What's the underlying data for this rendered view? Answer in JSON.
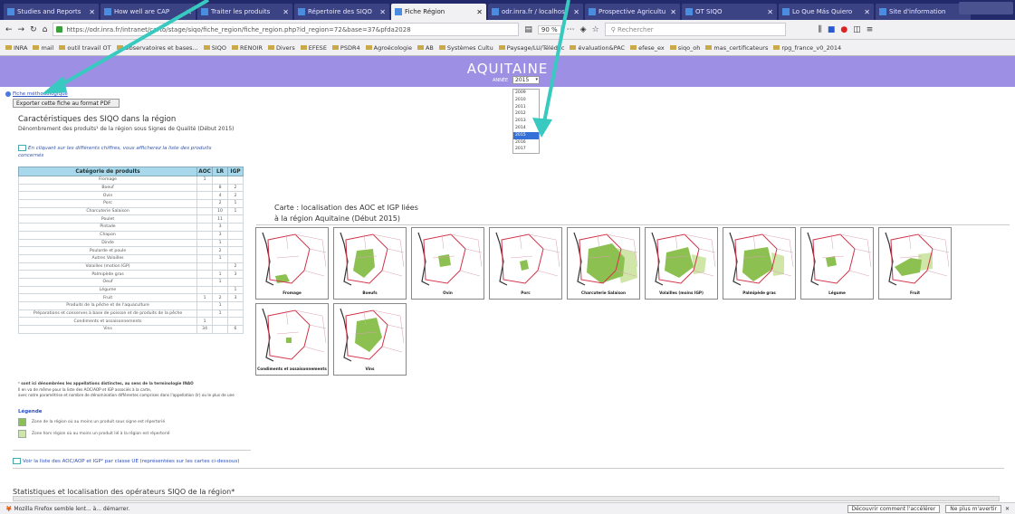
{
  "browser": {
    "tabs": [
      {
        "label": "Studies and Reports"
      },
      {
        "label": "How well are CAP"
      },
      {
        "label": "Traiter les produits"
      },
      {
        "label": "Répertoire des SIQO"
      },
      {
        "label": "Fiche Région",
        "active": true
      },
      {
        "label": "odr.inra.fr / localhost"
      },
      {
        "label": "Prospective Agricultu"
      },
      {
        "label": "OT SIQO"
      },
      {
        "label": "Lo Que Más Quiero"
      },
      {
        "label": "Site d'information"
      }
    ],
    "url": "https://odr.inra.fr/intranet/carto/stage/siqo/fiche_region/fiche_region.php?id_region=72&base=37&pfda2028",
    "zoom": "90 %",
    "search_placeholder": "Rechercher",
    "bookmarks": [
      "INRA",
      "mail",
      "outil travail OT",
      "Observatoires et bases...",
      "SIQO",
      "RENOIR",
      "Divers",
      "EFESE",
      "PSDR4",
      "Agroécologie",
      "AB",
      "Systèmes Cultu",
      "Paysage/LU/Télédéc",
      "évaluation&PAC",
      "efese_ex",
      "siqo_oh",
      "mas_certificateurs",
      "rpg_france_v0_2014"
    ],
    "status_text": "Mozilla Firefox semble lent... à... démarrer.",
    "status_btn1": "Découvrir comment l'accélérer",
    "status_btn2": "Ne plus m'avertir"
  },
  "banner": {
    "title": "AQUITAINE",
    "year_label": "ANNÉE",
    "year_value": "2015"
  },
  "year_options": [
    "2009",
    "2010",
    "2011",
    "2012",
    "2013",
    "2014",
    "2015",
    "2016",
    "2017"
  ],
  "year_selected_index": 6,
  "links": {
    "methodo": "Fiche méthodologique",
    "pdf_button": "Exporter cette fiche au format PDF"
  },
  "section1": {
    "title": "Caractéristiques des SIQO dans la région",
    "subtitle": "Dénombrement des produits¹ de la région sous Signes de Qualité (Début 2015)",
    "hint": "En cliquant sur les différents chiffres, vous afficherez la liste des produits concernés"
  },
  "table": {
    "headers": [
      "Catégorie de produits",
      "AOC",
      "LR",
      "IGP"
    ],
    "rows": [
      [
        "Fromage",
        "1",
        "",
        ""
      ],
      [
        "Boeuf",
        "",
        "8",
        "2"
      ],
      [
        "Ovin",
        "",
        "4",
        "2"
      ],
      [
        "Porc",
        "",
        "2",
        "1"
      ],
      [
        "Charcuterie Salaison",
        "",
        "10",
        "1"
      ],
      [
        "Poulet",
        "",
        "11",
        ""
      ],
      [
        "Pintade",
        "",
        "3",
        ""
      ],
      [
        "Chapon",
        "",
        "3",
        ""
      ],
      [
        "Dinde",
        "",
        "1",
        ""
      ],
      [
        "Poularde et poule",
        "",
        "2",
        ""
      ],
      [
        "Autres Volailles",
        "",
        "1",
        ""
      ],
      [
        "Volailles (motion IGP)",
        "",
        "",
        "2"
      ],
      [
        "Palmipède gras",
        "",
        "1",
        "3"
      ],
      [
        "Oeuf",
        "",
        "1",
        ""
      ],
      [
        "Légume",
        "",
        "",
        "1"
      ],
      [
        "Fruit",
        "1",
        "2",
        "3"
      ],
      [
        "Produits de la pêche et de l'aquaculture",
        "",
        "1",
        ""
      ],
      [
        "Préparations et conserves à base de poisson et de produits de la pêche",
        "",
        "1",
        ""
      ],
      [
        "Condiments et assaisonnements",
        "1",
        "",
        ""
      ],
      [
        "Vins",
        "34",
        "",
        "6"
      ]
    ]
  },
  "footnote": {
    "line1": "¹ sont ici dénombrées les appellations distinctes, au sens de la terminologie INAO",
    "line2": "Il en va de même pour la liste des AOC/AOP et IGP associés à la carte,",
    "line3": "avec notre paramétrise et nombre de dénomination différentes comprises dans l'appellation (lr) ou le plus de une"
  },
  "legend": {
    "title": "Légende",
    "item1": "Zone de la région où au moins un produit sous signe est répertorié",
    "item2": "Zone hors région où au moins un produit lié à la région est répertorié",
    "colors": {
      "dark": "#8cc152",
      "light": "#cfe6a8"
    }
  },
  "aoc_link": "Voir la liste des AOC/AOP et IGP² par classe UE (représentées sur les cartes ci-dessous)",
  "stats_title": "Statistiques et localisation des opérateurs SIQO de la région*",
  "carte": {
    "line1": "Carte : localisation des AOC et IGP liées",
    "line2": "à la région Aquitaine (Début 2015)"
  },
  "maps": [
    {
      "label": "Fromage"
    },
    {
      "label": "Boeufs"
    },
    {
      "label": "Ovin"
    },
    {
      "label": "Porc"
    },
    {
      "label": "Charcuterie Salaison"
    },
    {
      "label": "Volailles (moins IGP)"
    },
    {
      "label": "Palmipède gras"
    },
    {
      "label": "Légume"
    },
    {
      "label": "Fruit"
    },
    {
      "label": "Condiments et assaisonnements"
    },
    {
      "label": "Vins"
    }
  ]
}
